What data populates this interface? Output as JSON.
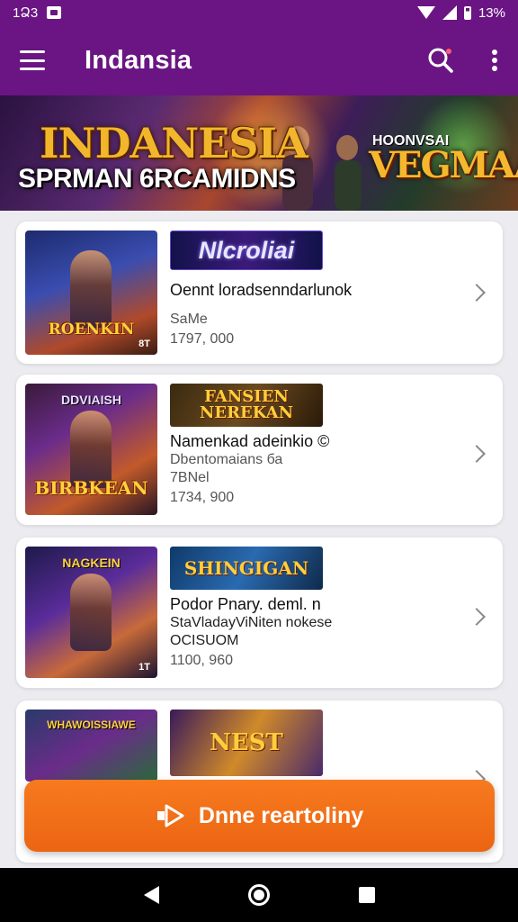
{
  "status_bar": {
    "time": "1Ձ3",
    "battery": "13%"
  },
  "app_bar": {
    "title": "Indansia"
  },
  "banner": {
    "title": "INDANESIA",
    "subtitle": "SPRMAN 6RCAMIDNS",
    "right_top": "HOONVSAI",
    "right_title": "VEGMAAS"
  },
  "games": [
    {
      "thumb_label": "ROENKIN",
      "thumb_badge": "8T",
      "logo_text": "Nlcroliai",
      "title": "Oennt loradsenndarlunok",
      "subtitle": "SaMe",
      "count": "1797, 000"
    },
    {
      "thumb_top": "DDVIAISH",
      "thumb_label": "BIRBKEAN",
      "logo_text": "FANSIEN NEREKAN",
      "title": "Namenkad adeinkio ©",
      "subtitle": "Dbentomaians   ба",
      "subtitle2": "7BNel",
      "count": "1734, 900"
    },
    {
      "thumb_top": "NAGKEIN",
      "thumb_badge": "1T",
      "logo_text": "SHINGIGAN",
      "title": "Podor Pnary. deml. n",
      "subtitle": "StaVladayViNiten nokese",
      "subtitle2": "OCISUOM",
      "count": "1100, 960"
    },
    {
      "thumb_top": "WHAWOISSIAWE",
      "logo_text": "NEST",
      "title": "",
      "count": ""
    }
  ],
  "cta": {
    "label": "Dnne reartoliny"
  },
  "colors": {
    "primary": "#6a1583",
    "accent": "#f06d17"
  }
}
